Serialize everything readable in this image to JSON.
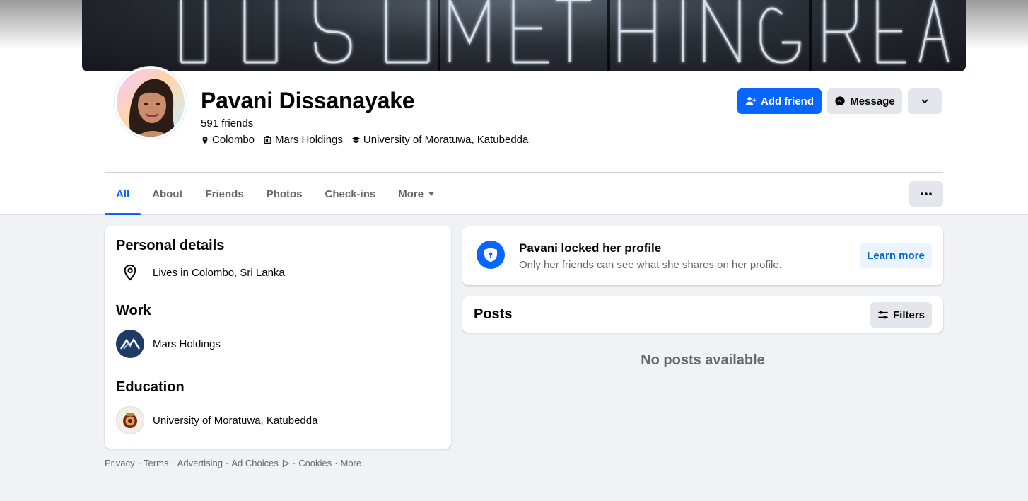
{
  "cover": {
    "text": "DO SOMETHING GREAT"
  },
  "profile": {
    "name": "Pavani Dissanayake",
    "friends": "591 friends",
    "meta": [
      {
        "icon": "location-pin-icon",
        "label": "Colombo"
      },
      {
        "icon": "briefcase-icon",
        "label": "Mars Holdings"
      },
      {
        "icon": "graduation-cap-icon",
        "label": "University of Moratuwa, Katubedda"
      }
    ]
  },
  "actions": {
    "add_friend": "Add friend",
    "message": "Message"
  },
  "tabs": [
    {
      "label": "All",
      "active": true
    },
    {
      "label": "About"
    },
    {
      "label": "Friends"
    },
    {
      "label": "Photos"
    },
    {
      "label": "Check-ins"
    },
    {
      "label": "More"
    }
  ],
  "intro": {
    "personal_title": "Personal details",
    "lives_in": "Lives in Colombo, Sri Lanka",
    "work_title": "Work",
    "work_place": "Mars Holdings",
    "education_title": "Education",
    "school": "University of Moratuwa, Katubedda"
  },
  "locked": {
    "title": "Pavani locked her profile",
    "subtitle": "Only her friends can see what she shares on her profile.",
    "learn_more": "Learn more"
  },
  "posts": {
    "title": "Posts",
    "filters": "Filters",
    "empty": "No posts available"
  },
  "footer": {
    "links": [
      "Privacy",
      "Terms",
      "Advertising",
      "Ad Choices",
      "Cookies",
      "More"
    ]
  },
  "colors": {
    "accent": "#0866ff",
    "page_bg": "#f0f2f5",
    "secondary_text": "#65676b",
    "gray_button": "#e4e6eb"
  }
}
